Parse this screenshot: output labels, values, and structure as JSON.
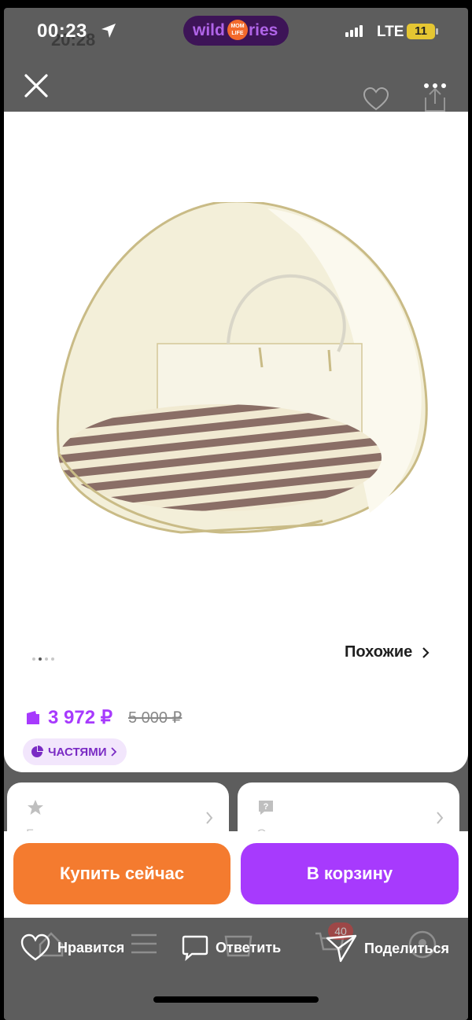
{
  "status_bar": {
    "time": "00:23",
    "time_ghost": "20:28",
    "network": "LTE",
    "battery": "11",
    "brand": {
      "left": "wild",
      "badge_top": "MOM",
      "badge_bottom": "LIFE",
      "right": "ries"
    }
  },
  "topbar": {
    "close_icon": "close-icon",
    "more_icon": "more-dots-icon"
  },
  "product": {
    "image_alt": "tent-image",
    "gallery_count": 3,
    "gallery_active": 1,
    "similar_label": "Похожие",
    "price_current": "3 972 ₽",
    "price_old": "5 000 ₽",
    "installments_label": "ЧАСТЯМИ"
  },
  "mini_cards": [
    {
      "icon": "star-icon",
      "ghost": "Без оценки"
    },
    {
      "icon": "question-icon",
      "ghost": "Спросить"
    }
  ],
  "actions": {
    "buy_now": "Купить сейчас",
    "add_to_cart": "В корзину"
  },
  "bottom_actions": {
    "like": "Нравится",
    "reply": "Ответить",
    "share": "Поделиться",
    "cart_badge": "40"
  },
  "colors": {
    "accent_purple": "#a73afd",
    "accent_orange": "#f47b2f",
    "overlay_gray": "#5d5d5d"
  }
}
